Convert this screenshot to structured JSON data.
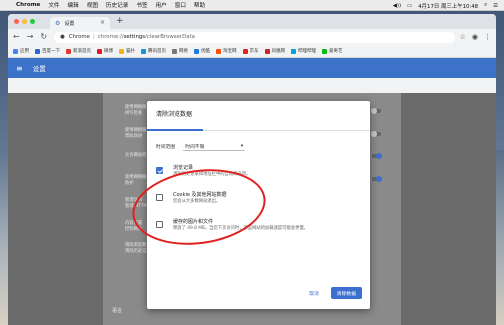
{
  "menubar": {
    "apple": "",
    "app": "Chrome",
    "items": [
      "文件",
      "编辑",
      "视图",
      "历史记录",
      "书签",
      "用户",
      "窗口",
      "帮助"
    ],
    "volume": "◀))",
    "clock": "4月17日 周三上午10:48"
  },
  "browser": {
    "tab_title": "设置",
    "new_tab": "+",
    "omnibox_prefix": "Chrome",
    "url_host": "chrome://",
    "url_path": "settings",
    "url_rest": "/clearBrowserData",
    "bookmarks": [
      {
        "label": "应用",
        "color": "#4285f4"
      },
      {
        "label": "百度一下",
        "color": "#2f62d4"
      },
      {
        "label": "新浪首页",
        "color": "#e3382b"
      },
      {
        "label": "微博",
        "color": "#e6162d"
      },
      {
        "label": "猫扑",
        "color": "#f3b31b"
      },
      {
        "label": "腾讯首页",
        "color": "#1b8fe0"
      },
      {
        "label": "网易",
        "color": "#777777"
      },
      {
        "label": "优酷",
        "color": "#1e7be1"
      },
      {
        "label": "淘宝网",
        "color": "#ff5000"
      },
      {
        "label": "京东",
        "color": "#e1251b"
      },
      {
        "label": "凤凰网",
        "color": "#c9242b"
      },
      {
        "label": "哔哩哔哩",
        "color": "#00a1d6"
      },
      {
        "label": "爱奇艺",
        "color": "#00be06"
      }
    ]
  },
  "settings": {
    "header": "设置",
    "rows": [
      {
        "label": "使用网络服务",
        "sub": "拼写检查"
      },
      {
        "label": "使用网络服务",
        "sub": "帮助改进"
      },
      {
        "label": "允许网站检查",
        "sub": ""
      },
      {
        "label": "使用网络服务",
        "sub": "防护"
      },
      {
        "label": "管理证书",
        "sub": "管理 HTTPS"
      },
      {
        "label": "内容设置",
        "sub": "控制网站"
      },
      {
        "label": "清除浏览数据",
        "sub": "清除历史记录"
      }
    ],
    "language_section": "语言",
    "language_row": "语言"
  },
  "dialog": {
    "title": "清除浏览数据",
    "time_range_label": "时间范围",
    "time_range_value": "时间不限",
    "options": [
      {
        "title": "浏览记录",
        "desc": "清除历史记录和地址栏中的自动填充项。",
        "checked": true
      },
      {
        "title": "Cookie 及其他网站数据",
        "desc": "您会从大多数网站退出。",
        "checked": false
      },
      {
        "title": "缓存的图片和文件",
        "desc": "释放了 49.8 MB。当您下次访问时，某些网站的加载速度可能会更慢。",
        "checked": false
      }
    ],
    "cancel": "取消",
    "confirm": "清除数据"
  },
  "colors": {
    "accent": "#3b6fd1",
    "annotation": "#e0201e",
    "settings_header": "#3c72c8"
  }
}
